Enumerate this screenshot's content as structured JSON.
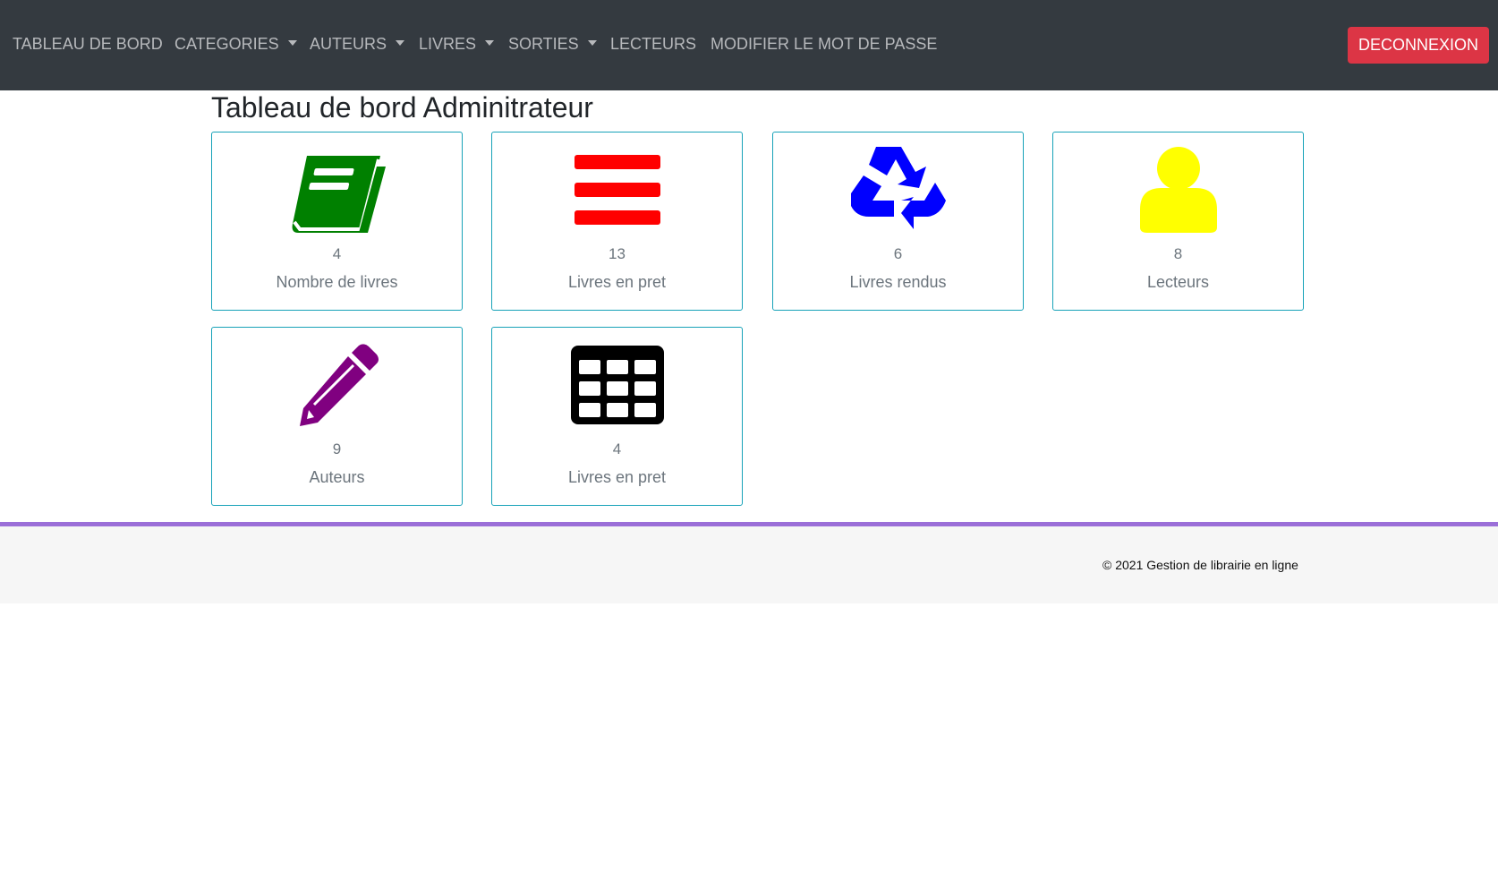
{
  "navbar": {
    "items": [
      {
        "label": "TABLEAU DE BORD",
        "dropdown": false
      },
      {
        "label": "CATEGORIES",
        "dropdown": true
      },
      {
        "label": "AUTEURS",
        "dropdown": true
      },
      {
        "label": "LIVRES",
        "dropdown": true
      },
      {
        "label": "SORTIES",
        "dropdown": true
      },
      {
        "label": "LECTEURS",
        "dropdown": false
      },
      {
        "label": "MODIFIER LE MOT DE PASSE",
        "dropdown": false
      }
    ],
    "logout_label": "DECONNEXION"
  },
  "page": {
    "title": "Tableau de bord Adminitrateur"
  },
  "cards": [
    {
      "count": "4",
      "label": "Nombre de livres",
      "icon": "book-icon",
      "color": "#008000"
    },
    {
      "count": "13",
      "label": "Livres en pret",
      "icon": "bars-icon",
      "color": "#ff0000"
    },
    {
      "count": "6",
      "label": "Livres rendus",
      "icon": "recycle-icon",
      "color": "#0000ff"
    },
    {
      "count": "8",
      "label": "Lecteurs",
      "icon": "user-icon",
      "color": "#ffff00"
    },
    {
      "count": "9",
      "label": "Auteurs",
      "icon": "pencil-icon",
      "color": "#800080"
    },
    {
      "count": "4",
      "label": "Livres en pret",
      "icon": "table-icon",
      "color": "#000000"
    }
  ],
  "footer": {
    "text": "© 2021 Gestion de librairie en ligne"
  },
  "colors": {
    "navbar_bg": "#343a40",
    "logout_bg": "#dc3545",
    "card_border": "#17a2b8",
    "footer_accent": "#9b6fd8",
    "footer_bg": "#f6f6f6"
  }
}
